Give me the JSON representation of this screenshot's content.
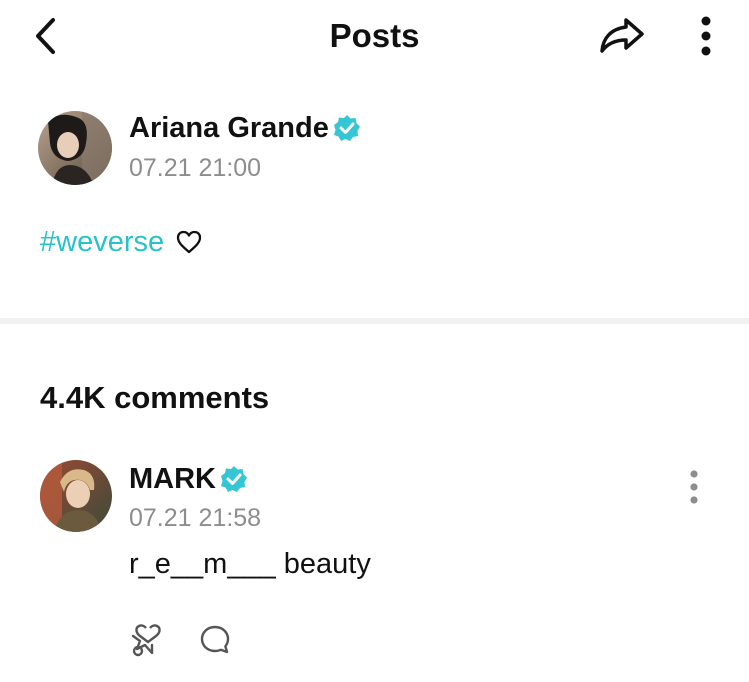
{
  "header": {
    "title": "Posts",
    "back_icon": "chevron-left-icon",
    "share_icon": "share-icon",
    "more_icon": "more-vertical-icon"
  },
  "post": {
    "author": "Ariana Grande",
    "verified": true,
    "time": "07.21 21:00",
    "hashtag": "#weverse",
    "heart_icon": "heart-outline-icon"
  },
  "comments": {
    "count_label": "4.4K comments",
    "items": [
      {
        "author": "MARK",
        "verified": true,
        "time": "07.21 21:58",
        "text": "r_e__m___ beauty",
        "more_icon": "more-vertical-icon",
        "react_icon": "reaction-icon",
        "reply_icon": "reply-bubble-icon"
      }
    ]
  },
  "colors": {
    "accent": "#27c3c9",
    "text": "#111111",
    "muted": "#8d8d8d",
    "divider": "#f1f1f3"
  }
}
